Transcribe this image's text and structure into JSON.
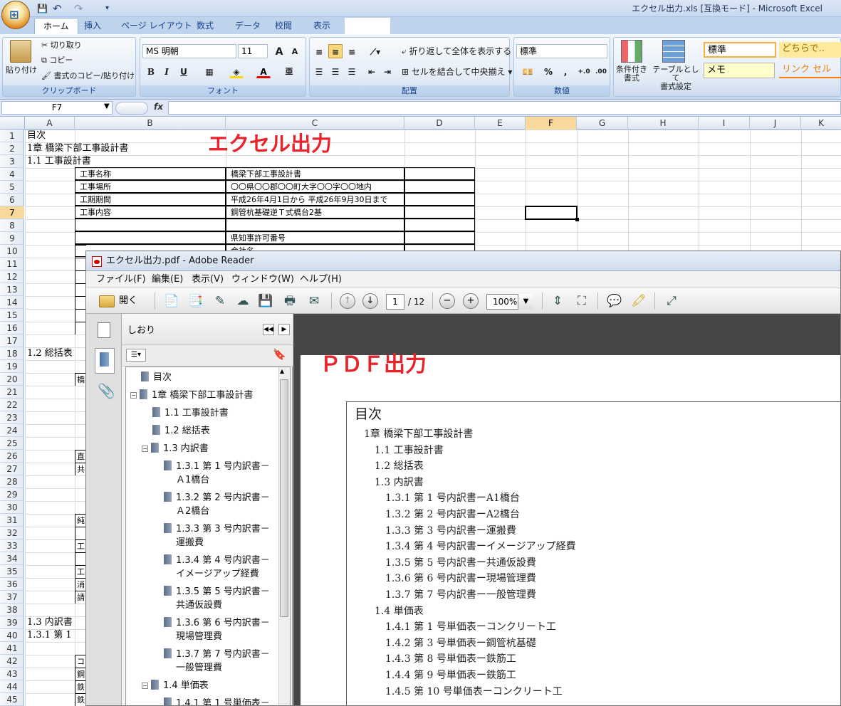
{
  "excel": {
    "quick_access": {
      "save": "💾",
      "undo": "↶",
      "redo": "↷",
      "more": "▾"
    },
    "window_title": "エクセル出力.xls  [互換モード] - Microsoft Excel",
    "tabs": [
      "ホーム",
      "挿入",
      "ページ レイアウト",
      "数式",
      "データ",
      "校閲",
      "表示"
    ],
    "active_tab": "ホーム",
    "ribbon": {
      "clipboard": {
        "label": "クリップボード",
        "paste": "貼り付け",
        "cut": "切り取り",
        "copy": "コピー",
        "format_painter": "書式のコピー/貼り付け"
      },
      "font": {
        "label": "フォント",
        "name": "MS 明朝",
        "size": "11",
        "grow": "A",
        "shrink": "A",
        "bold": "B",
        "italic": "I",
        "underline": "U"
      },
      "alignment": {
        "label": "配置",
        "wrap_text": "折り返して全体を表示する",
        "merge_center": "セルを結合して中央揃え"
      },
      "number": {
        "label": "数値",
        "format": "標準",
        "percent": "%",
        "comma": ","
      },
      "styles": {
        "conditional": "条件付き\n書式",
        "table_format": "テーブルとして\n書式設定",
        "style_normal": "標準",
        "style_neutral": "どちらで..",
        "style_memo": "メモ",
        "style_link": "リンク セル"
      }
    },
    "name_box": "F7",
    "fx": "fx",
    "columns": [
      "A",
      "B",
      "C",
      "D",
      "E",
      "F",
      "G",
      "H",
      "I",
      "J",
      "K"
    ],
    "selected_column": "F",
    "selected_row": 7,
    "rows": [
      "1",
      "2",
      "3",
      "4",
      "5",
      "6",
      "7",
      "8",
      "9",
      "10",
      "11",
      "12",
      "13",
      "14",
      "15",
      "16",
      "17",
      "18",
      "19",
      "20",
      "21",
      "22",
      "23",
      "24",
      "25",
      "26",
      "27",
      "28",
      "29",
      "30",
      "31",
      "32",
      "33",
      "34",
      "35",
      "36",
      "37",
      "38",
      "39",
      "40",
      "41",
      "42",
      "43",
      "44",
      "45"
    ],
    "cells": {
      "a1": "目次",
      "a2": "1章 橋梁下部工事設計書",
      "a3": "1.1 工事設計書",
      "a18": "1.2 総括表",
      "a39": "1.3 内訳書",
      "a40": "1.3.1 第 1"
    },
    "table": [
      [
        "工事名称",
        "橋梁下部工事設計書"
      ],
      [
        "工事場所",
        "〇〇県〇〇郡〇〇町大字〇〇字〇〇地内"
      ],
      [
        "工期期間",
        "平成26年4月1日から 平成26年9月30日まで"
      ],
      [
        "工事内容",
        "鋼管杭基礎逆Ｔ式橋台2基"
      ],
      [
        "",
        ""
      ],
      [
        "",
        "県知事許可番号"
      ],
      [
        "",
        "会社名"
      ]
    ],
    "b_slivers": [
      {
        "row": 20,
        "text": "橋"
      },
      {
        "row": 26,
        "text": "直"
      },
      {
        "row": 27,
        "text": "共"
      },
      {
        "row": 31,
        "text": "純"
      },
      {
        "row": 33,
        "text": "工"
      },
      {
        "row": 35,
        "text": "工"
      },
      {
        "row": 36,
        "text": "消"
      },
      {
        "row": 37,
        "text": "請"
      },
      {
        "row": 42,
        "text": "コ"
      },
      {
        "row": 43,
        "text": "鋼"
      },
      {
        "row": 44,
        "text": "鉄"
      },
      {
        "row": 45,
        "text": "鉄"
      }
    ],
    "overlay_title": "エクセル出力"
  },
  "reader": {
    "window_title": "エクセル出力.pdf - Adobe Reader",
    "menu": [
      "ファイル(F)",
      "編集(E)",
      "表示(V)",
      "ウィンドウ(W)",
      "ヘルプ(H)"
    ],
    "open_label": "開く",
    "page_current": "1",
    "page_total": "/ 12",
    "zoom": "100%",
    "panel_title": "しおり",
    "bookmarks": [
      {
        "level": 0,
        "toggle": "",
        "text": "目次"
      },
      {
        "level": 0,
        "toggle": "−",
        "text": "1章 橋梁下部工事設計書"
      },
      {
        "level": 1,
        "toggle": "",
        "text": "1.1 工事設計書"
      },
      {
        "level": 1,
        "toggle": "",
        "text": "1.2 総括表"
      },
      {
        "level": 1,
        "toggle": "−",
        "text": "1.3 内訳書"
      },
      {
        "level": 2,
        "toggle": "",
        "text": "1.3.1 第 1 号内訳書－",
        "text2": "Ａ1橋台"
      },
      {
        "level": 2,
        "toggle": "",
        "text": "1.3.2 第 2 号内訳書－",
        "text2": "Ａ2橋台"
      },
      {
        "level": 2,
        "toggle": "",
        "text": "1.3.3 第 3 号内訳書－",
        "text2": "運搬費"
      },
      {
        "level": 2,
        "toggle": "",
        "text": "1.3.4 第 4 号内訳書－",
        "text2": "イメージアップ経費"
      },
      {
        "level": 2,
        "toggle": "",
        "text": "1.3.5 第 5 号内訳書－",
        "text2": "共通仮設費"
      },
      {
        "level": 2,
        "toggle": "",
        "text": "1.3.6 第 6 号内訳書－",
        "text2": "現場管理費"
      },
      {
        "level": 2,
        "toggle": "",
        "text": "1.3.7 第 7 号内訳書－",
        "text2": "一般管理費"
      },
      {
        "level": 1,
        "toggle": "−",
        "text": "1.4 単価表"
      },
      {
        "level": 2,
        "toggle": "",
        "text": "1.4.1 第 1 号単価表－"
      }
    ],
    "overlay_title": "ＰＤＦ出力",
    "toc": [
      {
        "level": 0,
        "text": "目次"
      },
      {
        "level": 1,
        "text": "1章  橋梁下部工事設計書"
      },
      {
        "level": 2,
        "text": "1.1  工事設計書"
      },
      {
        "level": 2,
        "text": "1.2  総括表"
      },
      {
        "level": 2,
        "text": "1.3  内訳書"
      },
      {
        "level": 3,
        "text": "1.3.1  第  1  号内訳書ーA1橋台"
      },
      {
        "level": 3,
        "text": "1.3.2  第  2  号内訳書ーA2橋台"
      },
      {
        "level": 3,
        "text": "1.3.3  第  3  号内訳書ー運搬費"
      },
      {
        "level": 3,
        "text": "1.3.4  第  4  号内訳書ーイメージアップ経費"
      },
      {
        "level": 3,
        "text": "1.3.5  第  5  号内訳書ー共通仮設費"
      },
      {
        "level": 3,
        "text": "1.3.6  第  6  号内訳書ー現場管理費"
      },
      {
        "level": 3,
        "text": "1.3.7  第  7  号内訳書ー一般管理費"
      },
      {
        "level": 2,
        "text": "1.4  単価表"
      },
      {
        "level": 3,
        "text": "1.4.1  第  1  号単価表ーコンクリート工"
      },
      {
        "level": 3,
        "text": "1.4.2  第  3  号単価表ー鋼管杭基礎"
      },
      {
        "level": 3,
        "text": "1.4.3  第  8  号単価表ー鉄筋工"
      },
      {
        "level": 3,
        "text": "1.4.4  第  9  号単価表ー鉄筋工"
      },
      {
        "level": 3,
        "text": "1.4.5  第  10  号単価表ーコンクリート工"
      }
    ]
  }
}
